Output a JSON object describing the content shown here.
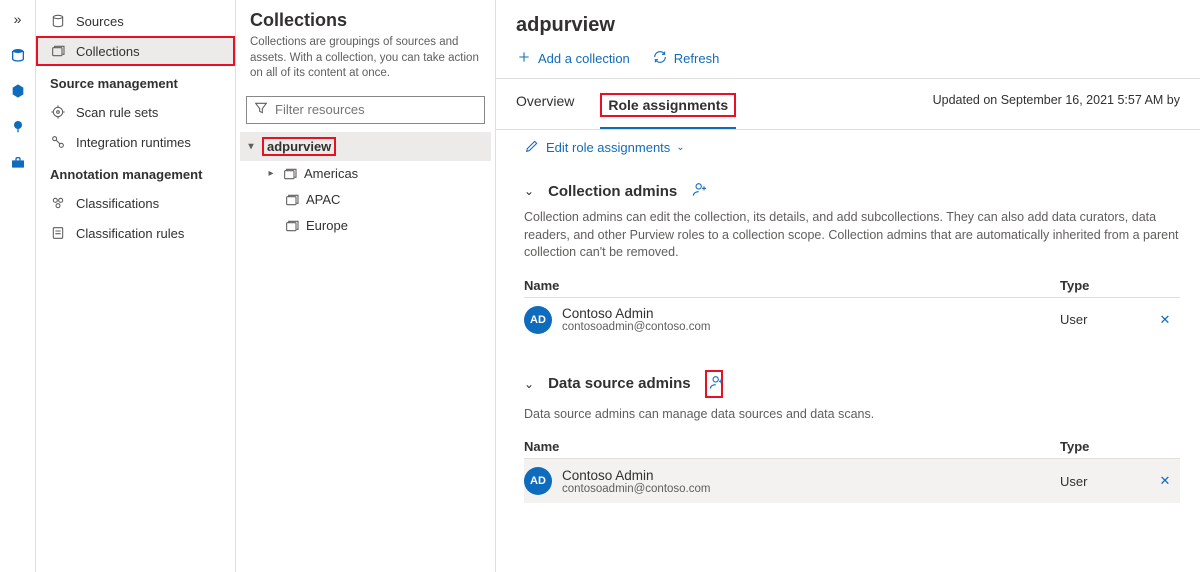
{
  "rail": {
    "expand": "»"
  },
  "sidebar": {
    "items": [
      {
        "label": "Sources"
      },
      {
        "label": "Collections"
      }
    ],
    "group_source": "Source management",
    "source_items": [
      {
        "label": "Scan rule sets"
      },
      {
        "label": "Integration runtimes"
      }
    ],
    "group_annotation": "Annotation management",
    "annotation_items": [
      {
        "label": "Classifications"
      },
      {
        "label": "Classification rules"
      }
    ]
  },
  "mid": {
    "title": "Collections",
    "description": "Collections are groupings of sources and assets. With a collection, you can take action on all of its content at once.",
    "filter_placeholder": "Filter resources",
    "tree": {
      "root": "adpurview",
      "children": [
        {
          "label": "Americas",
          "expandable": true
        },
        {
          "label": "APAC",
          "expandable": false
        },
        {
          "label": "Europe",
          "expandable": false
        }
      ]
    }
  },
  "main": {
    "title": "adpurview",
    "toolbar": {
      "add_collection": "Add a collection",
      "refresh": "Refresh"
    },
    "tabs": {
      "overview": "Overview",
      "role": "Role assignments"
    },
    "updated": "Updated on September 16, 2021 5:57 AM by",
    "edit_link": "Edit role assignments",
    "sections": {
      "collection_admins": {
        "title": "Collection admins",
        "desc": "Collection admins can edit the collection, its details, and add subcollections. They can also add data curators, data readers, and other Purview roles to a collection scope. Collection admins that are automatically inherited from a parent collection can't be removed.",
        "name_header": "Name",
        "type_header": "Type",
        "rows": [
          {
            "initials": "AD",
            "name": "Contoso Admin",
            "email": "contosoadmin@contoso.com",
            "type": "User"
          }
        ]
      },
      "data_source_admins": {
        "title": "Data source admins",
        "desc": "Data source admins can manage data sources and data scans.",
        "name_header": "Name",
        "type_header": "Type",
        "rows": [
          {
            "initials": "AD",
            "name": "Contoso Admin",
            "email": "contosoadmin@contoso.com",
            "type": "User"
          }
        ]
      }
    }
  }
}
